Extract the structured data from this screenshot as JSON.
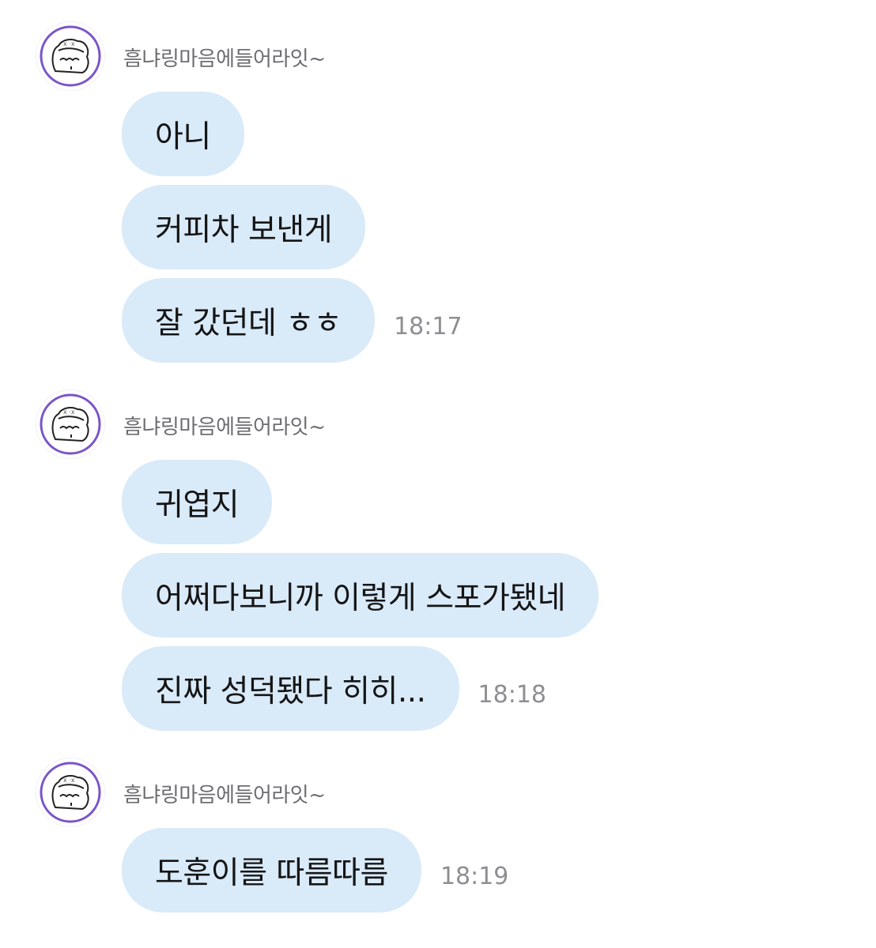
{
  "sender_name": "흠냐링마음에들어라잇~",
  "avatar_icon": "cute-face-doodle-icon",
  "colors": {
    "bubble": "#d9eaf9",
    "avatar_outline": "#7a55c8"
  },
  "groups": [
    {
      "messages": [
        "아니",
        "커피차 보낸게",
        "잘 갔던데 ㅎㅎ"
      ],
      "time": "18:17"
    },
    {
      "messages": [
        "귀엽지",
        "어쩌다보니까 이렇게 스포가됐네",
        "진짜 성덕됐다 히히..."
      ],
      "time": "18:18"
    },
    {
      "messages": [
        "도훈이를 따름따름"
      ],
      "time": "18:19"
    }
  ]
}
